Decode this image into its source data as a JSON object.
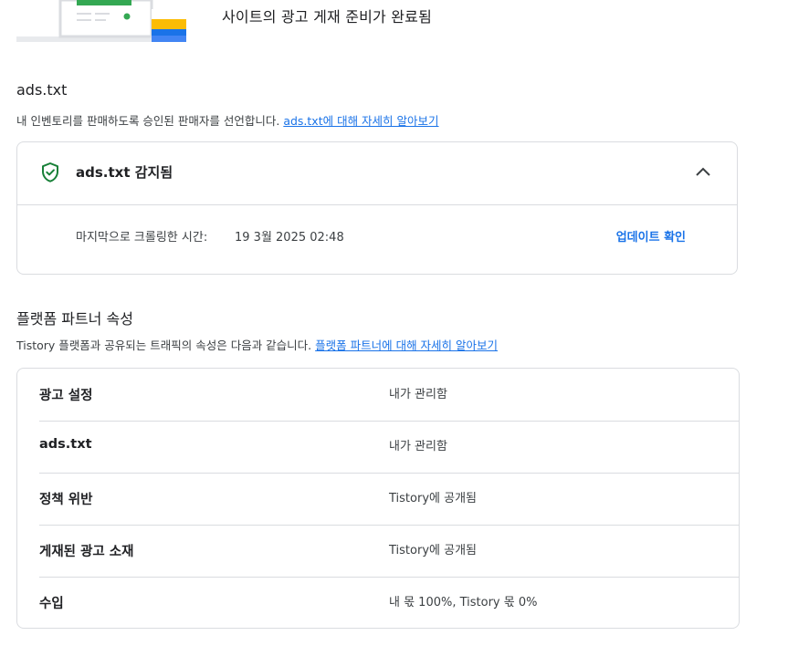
{
  "banner": {
    "title": "사이트의 광고 게재 준비가 완료됨"
  },
  "ads_txt": {
    "title": "ads.txt",
    "description": "내 인벤토리를 판매하도록 승인된 판매자를 선언합니다.",
    "learn_more": "ads.txt에 대해 자세히 알아보기",
    "status_title": "ads.txt 감지됨",
    "crawl_label": "마지막으로 크롤링한 시간:",
    "crawl_value": "19 3월 2025 02:48",
    "update_button": "업데이트 확인",
    "status_color": "#188038"
  },
  "partner": {
    "title": "플랫폼 파트너 속성",
    "description": "Tistory 플랫폼과 공유되는 트래픽의 속성은 다음과 같습니다.",
    "learn_more": "플랫폼 파트너에 대해 자세히 알아보기",
    "rows": [
      {
        "key": "광고 설정",
        "value": "내가 관리함"
      },
      {
        "key": "ads.txt",
        "value": "내가 관리함"
      },
      {
        "key": "정책 위반",
        "value": "Tistory에 공개됨"
      },
      {
        "key": "게재된 광고 소재",
        "value": "Tistory에 공개됨"
      },
      {
        "key": "수입",
        "value": "내 몫 100%, Tistory 몫 0%"
      }
    ]
  },
  "colors": {
    "link": "#1a73e8",
    "border": "#dadce0",
    "text": "#202124"
  }
}
